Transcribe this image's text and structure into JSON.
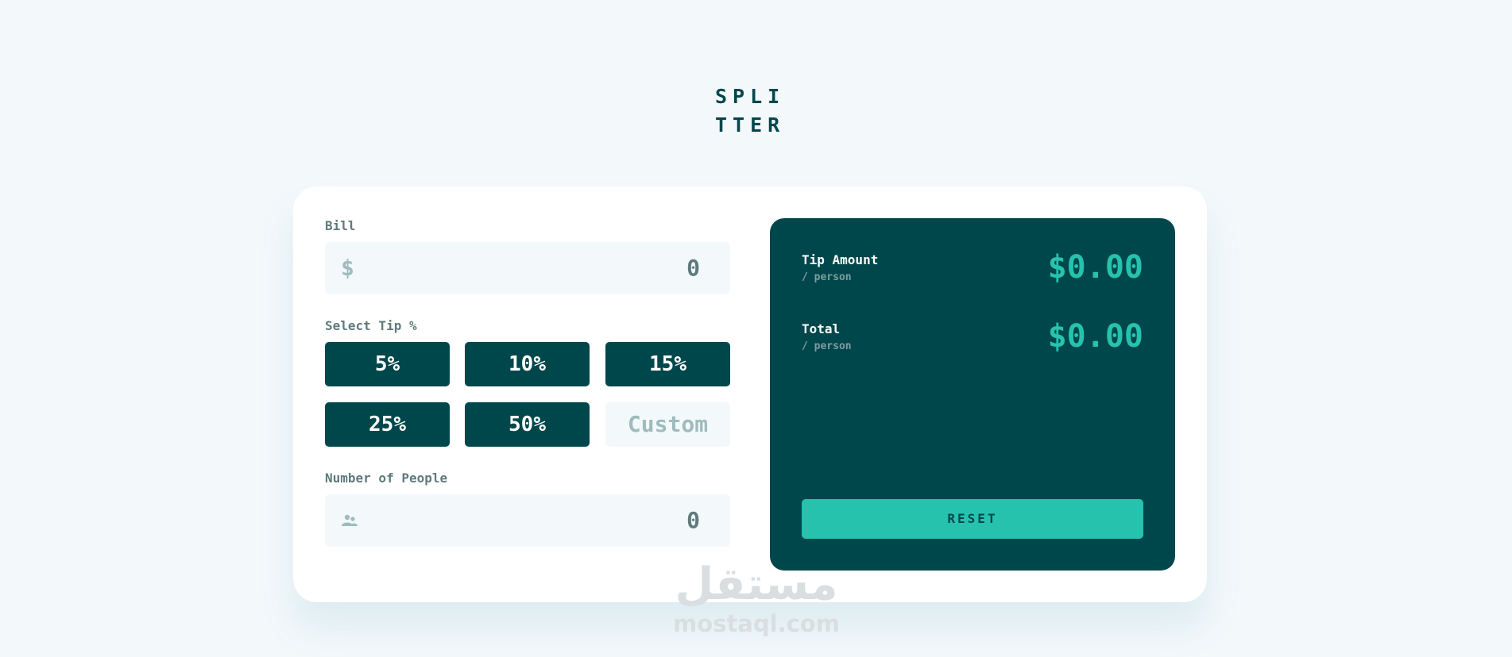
{
  "app": {
    "logo_line1": "SPLI",
    "logo_line2": "TTER"
  },
  "bill": {
    "label": "Bill",
    "prefix": "$",
    "value": "0",
    "icon": "dollar-icon"
  },
  "tip": {
    "label": "Select Tip %",
    "options": [
      "5%",
      "10%",
      "15%",
      "25%",
      "50%"
    ],
    "custom_placeholder": "Custom"
  },
  "people": {
    "label": "Number of People",
    "value": "0",
    "icon": "person-icon"
  },
  "results": {
    "tip_amount_label": "Tip Amount",
    "tip_amount_sub": "/ person",
    "tip_amount_value": "$0.00",
    "total_label": "Total",
    "total_sub": "/ person",
    "total_value": "$0.00",
    "reset_label": "RESET"
  },
  "watermark": {
    "arabic": "مستقل",
    "domain": "mostaql.com"
  },
  "colors": {
    "background": "#f3f8fb",
    "dark_cyan": "#00474b",
    "accent": "#26c2ae",
    "label_gray": "#5e7a7d",
    "muted": "#9ebbbd"
  }
}
